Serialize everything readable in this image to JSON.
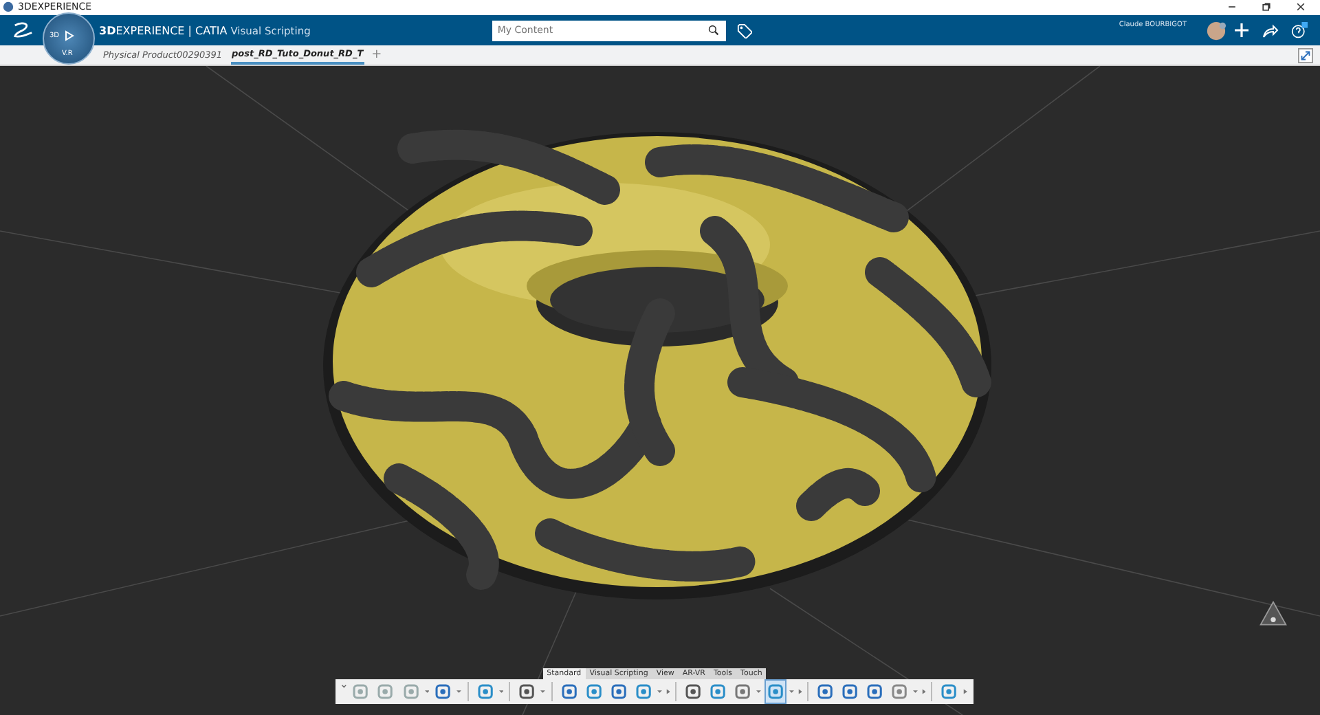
{
  "window": {
    "title": "3DEXPERIENCE"
  },
  "top_bar": {
    "brand_bold": "3D",
    "brand_rest": "EXPERIENCE | CATIA",
    "app": "Visual Scripting",
    "compass_left": "3D",
    "compass_bottom": "V.R",
    "search": {
      "placeholder": "My Content"
    },
    "user": "Claude BOURBIGOT"
  },
  "tabs": [
    {
      "label": "Physical Product00290391",
      "selected": false
    },
    {
      "label": "post_RD_Tuto_Donut_RD_T",
      "selected": true
    }
  ],
  "new_tab": "+",
  "toolbar_tabs": [
    {
      "label": "Standard",
      "selected": true
    },
    {
      "label": "Visual Scripting",
      "selected": false
    },
    {
      "label": "View",
      "selected": false
    },
    {
      "label": "AR-VR",
      "selected": false
    },
    {
      "label": "Tools",
      "selected": false
    },
    {
      "label": "Touch",
      "selected": false
    }
  ],
  "toolbar_buttons": [
    {
      "selected": false
    },
    {
      "selected": false
    },
    {
      "selected": false
    },
    {
      "selected": false
    },
    {
      "selected": false
    },
    {
      "selected": false
    },
    {
      "selected": false
    },
    {
      "selected": false
    },
    {
      "selected": false
    },
    {
      "selected": false
    },
    {
      "selected": false
    },
    {
      "selected": false
    },
    {
      "selected": false
    },
    {
      "selected": true
    },
    {
      "selected": false
    },
    {
      "selected": false
    },
    {
      "selected": false
    },
    {
      "selected": false
    },
    {
      "selected": false
    }
  ]
}
